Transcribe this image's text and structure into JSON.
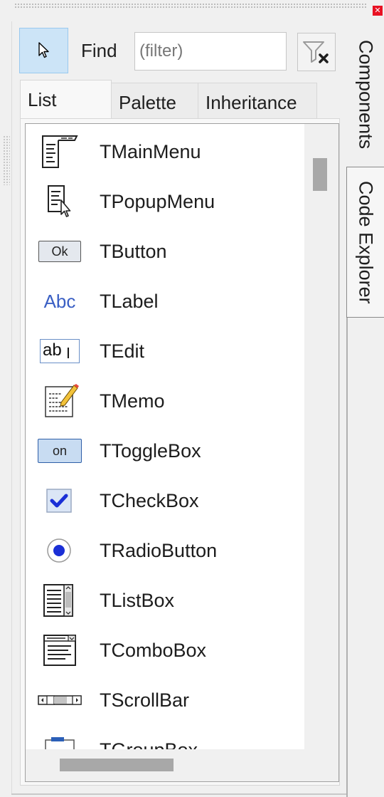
{
  "toolbar": {
    "select_tool_icon": "arrow-cursor-icon",
    "find_label": "Find",
    "filter_placeholder": "(filter)",
    "clear_filter_icon": "funnel-clear-icon"
  },
  "tabs": [
    {
      "label": "List",
      "active": true
    },
    {
      "label": "Palette",
      "active": false
    },
    {
      "label": "Inheritance",
      "active": false
    }
  ],
  "components": [
    {
      "label": "TMainMenu",
      "icon": "main-menu-icon"
    },
    {
      "label": "TPopupMenu",
      "icon": "popup-menu-icon"
    },
    {
      "label": "TButton",
      "icon": "button-icon",
      "icon_text": "Ok"
    },
    {
      "label": "TLabel",
      "icon": "label-icon",
      "icon_text": "Abc"
    },
    {
      "label": "TEdit",
      "icon": "edit-icon",
      "icon_text": "ab"
    },
    {
      "label": "TMemo",
      "icon": "memo-icon"
    },
    {
      "label": "TToggleBox",
      "icon": "toggle-box-icon",
      "icon_text": "on"
    },
    {
      "label": "TCheckBox",
      "icon": "checkbox-icon"
    },
    {
      "label": "TRadioButton",
      "icon": "radio-button-icon"
    },
    {
      "label": "TListBox",
      "icon": "list-box-icon"
    },
    {
      "label": "TComboBox",
      "icon": "combo-box-icon"
    },
    {
      "label": "TScrollBar",
      "icon": "scroll-bar-icon"
    },
    {
      "label": "TGroupBox",
      "icon": "group-box-icon"
    }
  ],
  "side_tabs": {
    "components": "Components",
    "code_explorer": "Code Explorer"
  },
  "colors": {
    "selected_tool_bg": "#cce4f7",
    "accent_blue": "#1a2fd6",
    "close_red": "#e81123"
  }
}
